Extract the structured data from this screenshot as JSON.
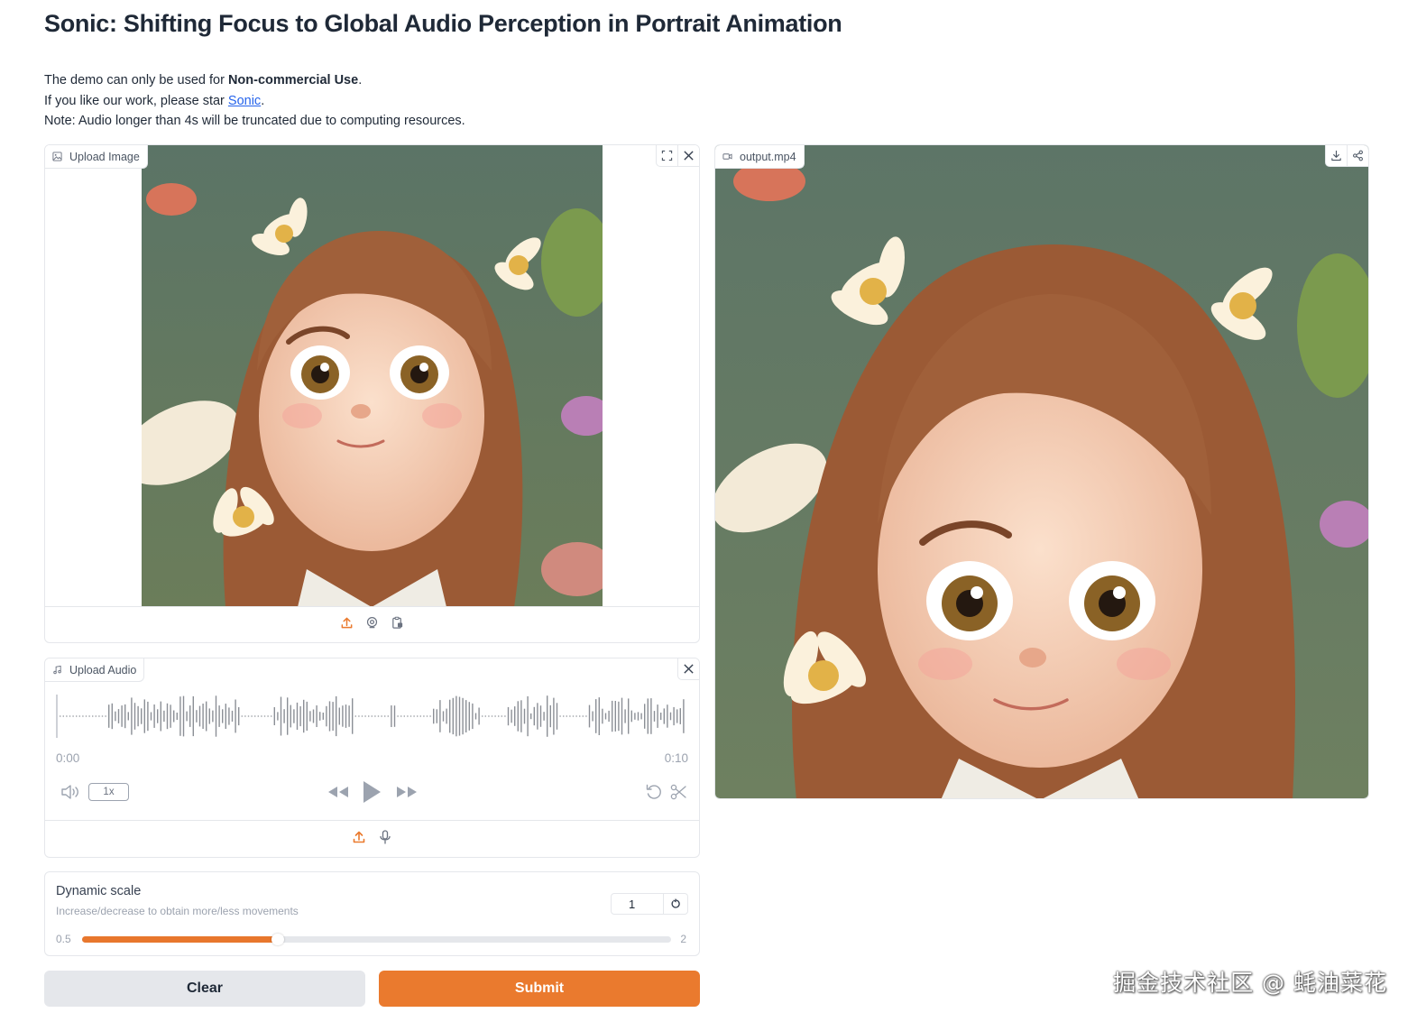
{
  "page": {
    "title": "Sonic: Shifting Focus to Global Audio Perception in Portrait Animation",
    "intro_line1_prefix": "The demo can only be used for ",
    "intro_line1_bold": "Non-commercial Use",
    "intro_line1_suffix": ".",
    "intro_line2_prefix": "If you like our work, please star ",
    "intro_line2_link": "Sonic",
    "intro_line2_suffix": ".",
    "intro_line3": "Note: Audio longer than 4s will be truncated due to computing resources."
  },
  "image_input": {
    "label": "Upload Image",
    "label_icon": "image-icon",
    "corner_icons": [
      "fullscreen-icon",
      "close-icon"
    ],
    "source_icons": [
      "upload-icon",
      "webcam-icon",
      "clipboard-icon"
    ]
  },
  "audio_input": {
    "label": "Upload Audio",
    "label_icon": "music-note-icon",
    "current_time": "0:00",
    "duration": "0:10",
    "playback_speed": "1x",
    "source_icons": [
      "upload-icon",
      "microphone-icon"
    ]
  },
  "slider": {
    "label": "Dynamic scale",
    "info": "Increase/decrease to obtain more/less movements",
    "value": "1",
    "min": "0.5",
    "max": "2",
    "value_fraction": 0.333
  },
  "buttons": {
    "clear": "Clear",
    "submit": "Submit"
  },
  "output_video": {
    "label": "output.mp4",
    "label_icon": "video-icon",
    "corner_icons": [
      "download-icon",
      "share-icon"
    ]
  },
  "colors": {
    "accent": "#ea7a2e",
    "link": "#2563eb"
  },
  "watermark": "掘金技术社区 @ 蚝油菜花"
}
